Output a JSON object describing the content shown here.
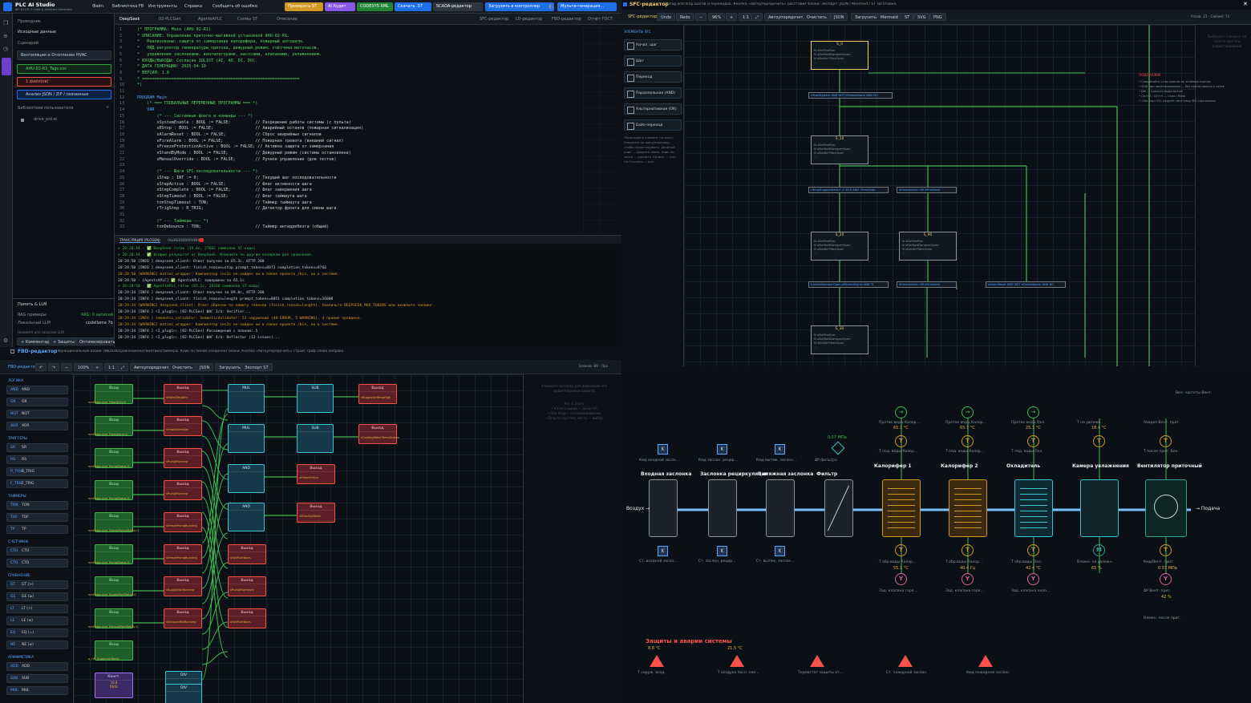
{
  "app": {
    "title": "PLC AI Studio",
    "subtitle": "IEC 61131-3 Code & Architect Generator",
    "menu": [
      "Файл",
      "Библиотека FB",
      "Инструменты",
      "Справка",
      "Сообщить об ошибке"
    ],
    "actions": [
      {
        "label": "Проверить ST",
        "color": "#d29922"
      },
      {
        "label": "AI Аудит",
        "color": "#8957e5"
      },
      {
        "label": "CODESYS XML",
        "color": "#238636"
      },
      {
        "label": "Скачать .ST",
        "color": "#1f6feb"
      },
      {
        "label": "SCADA-редактор",
        "color": "#30363d"
      },
      {
        "label": "Загрузить в контроллер",
        "color": "#1f6feb"
      },
      {
        "label": "Мульти-генерация...",
        "color": "#1f6feb"
      }
    ],
    "tabs": [
      "DeepSeek",
      "02-PLCGen",
      "AgentsAPLC",
      "Схемы ST",
      "Описание"
    ],
    "tabs_right": [
      "SFC-редактор",
      "LD-редактор",
      "FBD-редактор",
      "Отчёт ГОСТ"
    ]
  },
  "sidebar": {
    "section": "Проводник",
    "sub": "Исходные данные",
    "label2": "Сценарий",
    "scenario": "Вентиляция и Отопление HVAC",
    "file": "AHU-02-R1_Tags.csv",
    "errors": "1 файл(ов)",
    "analyze": "Анализ JSON / ZIP / связанные",
    "lib": "Библиотеки пользователя",
    "libfile": "drive_pid.st",
    "llm": "Память & LLM",
    "rag": "RAG примеры",
    "rag_v": "RAG: 0 записей",
    "local": "Локальный LLM",
    "local_v": "codellama 7b",
    "hint": "Нажмите для загрузки LLM",
    "btns": [
      "+ Комментарии",
      "+ Защиты",
      "Оптимизировать"
    ]
  },
  "code": [
    [
      "1",
      "(* ПРОГРАММА: Main (AHU-02-R1)",
      "cm"
    ],
    [
      "2",
      "* ОПИСАНИЕ: Управление приточно-вытяжной установкой AHU-02-R1.",
      "cm"
    ],
    [
      "3",
      "*   Реализованы: защита от замерзания калорифера, пожарный алгоритм,",
      "cm"
    ],
    [
      "4",
      "*   ПИД-регулятор температуры притока, дежурный режим, счётчики моточасов,",
      "cm"
    ],
    [
      "5",
      "*   управление заслонками, вентиляторами, насосами, клапанами, увлажнением.",
      "cm"
    ],
    [
      "6",
      "* ВХОДЫ/ВЫХОДЫ: Согласно IOLIST (AI, AO, DI, DO).",
      "cm"
    ],
    [
      "7",
      "* ДАТА ГЕНЕРАЦИИ: 2025-04-10",
      "cm"
    ],
    [
      "8",
      "* ВЕРСИЯ: 1.0",
      "cm"
    ],
    [
      "9",
      "* ================================================================",
      "cm"
    ],
    [
      "10",
      "*)",
      "cm"
    ],
    [
      "11",
      "",
      ""
    ],
    [
      "12",
      "PROGRAM Main",
      "kw"
    ],
    [
      "13",
      "    (* === ГЛОБАЛЬНЫЕ ПЕРЕМЕННЫЕ ПРОГРАММЫ === *)",
      "cm"
    ],
    [
      "14",
      "    VAR",
      "kw"
    ],
    [
      "15",
      "        (* --- Системные флаги и команды --- *)",
      "cm"
    ],
    [
      "16",
      "        xSystemEnable : BOOL := FALSE;          // Разрешение работы системы (с пульта)",
      ""
    ],
    [
      "17",
      "        xEStop : BOOL := FALSE;                 // Аварийный останов (пожарная сигнализация)",
      ""
    ],
    [
      "18",
      "        xAlarmReset : BOOL := FALSE;            // Сброс аварийных сигналов",
      ""
    ],
    [
      "19",
      "        xFireAlarm : BOOL := FALSE;             // Пожарная тревога (внешний сигнал)",
      ""
    ],
    [
      "20",
      "        xFreezeProtectionActive : BOOL := FALSE; // Активна защита от замерзания",
      ""
    ],
    [
      "21",
      "        xStandByMode : BOOL := FALSE;           // Дежурный режим (система остановлена)",
      ""
    ],
    [
      "22",
      "        xManualOverride : BOOL := FALSE;        // Ручное управление (для тестов)",
      ""
    ],
    [
      "23",
      "",
      ""
    ],
    [
      "24",
      "        (* --- Шаги SFC-последовательности --- *)",
      "cm"
    ],
    [
      "25",
      "        iStep : INT := 0;                       // Текущий шаг последовательности",
      ""
    ],
    [
      "26",
      "        xStepActive : BOOL := FALSE;            // Флаг активности шага",
      ""
    ],
    [
      "27",
      "        xStepComplete : BOOL := FALSE;          // Флаг завершения шага",
      ""
    ],
    [
      "28",
      "        xStepTimeout : BOOL := FALSE;           // Флаг таймаута шага",
      ""
    ],
    [
      "29",
      "        tonStepTimeout : TON;                   // Таймер таймаута шага",
      ""
    ],
    [
      "30",
      "        rTrigStep : R_TRIG;                     // Детектор фронта для смены шага",
      ""
    ],
    [
      "31",
      "",
      ""
    ],
    [
      "32",
      "        (* --- Таймеры --- *)",
      "cm"
    ],
    [
      "33",
      "        tonDebounce : TON;                      // Таймер антидребезга (общий)",
      ""
    ]
  ],
  "log_tabs": [
    "ТРАНСЛЯЦИЯ (PLCGEN)",
    "ОШИБКИ/ВАРНИНГИ"
  ],
  "log": [
    "> 20:28:44 - ✅ DeepSeek готов (39.8с, 27682 символов ST-кода)",
    "> 20:28:44 - ✅ Вторые результат от DeepSeek. Кликайте по другим вкладкам для сравнения.",
    "20:28:50 [INFO ] deepseek_client: Ответ получен за 65.3с, HTTP 200",
    "20:28:50 [INFO ] deepseek_client: finish_reason=stop prompt_tokens=8873 completion_tokens=9766",
    "20:28:50 [WARNING] matiec_wrapper: Компилятор iec2c не найден ни в папке проекта /bin, ни в системе.",
    "20:28:50 - [AgentsAPLC] ✅ AgentsAPLC: завершено за 65.1с",
    "> 20:28:50 - ✅ AgentsAPLC готов (65.1с, 28318 символов ST-кода)",
    "20:29:34 [INFO ] deepseek_client: Ответ получен за 89.0с, HTTP 200",
    "20:29:34 [INFO ] deepseek_client: finish_reason=length prompt_tokens=8051 completion_tokens=16000",
    "20:29:34 [WARNING] deepseek_client: Ответ обрезан по лимиту токенов (finish_reason=length). Увеличьте DEEPSEEK_MAX_TOKENS или включите чанкинг.",
    "20:29:34 [INFO ] r2_plugin: [02-PLCGen] ШАГ 3/4: Verifier...",
    "20:29:34 [INFO ] semantic_validator: SemanticValidator: 53 нарушений (48 ERROR, 5 WARNING), 4 правил пройдено.",
    "20:29:34 [WARNING] matiec_wrapper: Компилятор iec2c не найден ни в папке проекта /bin, ни в системе.",
    "20:29:34 [INFO ] r2_plugin: [02-PLCGen] Расхождений с планом: 5",
    "20:29:34 [INFO ] r2_plugin: [02-PLCGen] ШАГ 4/4: Reflector (13 issues)..."
  ],
  "sfc": {
    "title": "SFC-редактор",
    "hint": "Drag and drop шагов и переходов. Кнопка «Автоупорядочить» расставит блоки. Экспорт: JSON / Mermaid / ST заготовка.",
    "toolbar": [
      "SFC-редактор",
      "Undo",
      "Redo",
      "−",
      "96%",
      "+",
      "1:1",
      "⤢",
      "Автоупорядочить",
      "Очистить",
      "JSON",
      "Загрузить",
      "Mermaid",
      "ST",
      "SVG",
      "PNG"
    ],
    "status": "Узлов: 23 · Связей: 74",
    "pal_title": "ЭЛЕМЕНТЫ SFC",
    "pal": [
      "Начал. шаг",
      "Шаг",
      "Переход",
      "Параллельная (AND)",
      "Альтернативная (OR)",
      "Байп-переход"
    ],
    "pal_note": "Перетащите элемент на холст. Кликните по шагу/переходу, чтобы редактировать. Двойной клик — удалить связь. Клик по связи — удалить. Колесо — зум. Ctrl+колесо — pan.",
    "help_title": "ПОДСКАЗКИ",
    "help": [
      "• Соединяйте узлы кликом по зелёным портам",
      "• Shift при перетаскивании — без притягивания к сетке",
      "• Del — удалить выделенное",
      "• Ctrl+Z / Ctrl+Y — Undo / Redo",
      "• «Экспорт ST» создаёт заготовку SFC-программы"
    ],
    "placeholder": "Выберите элемент на холсте для его редактирования",
    "steps": [
      {
        "name": "S_0",
        "lines": [
          "N  xDelFanRun",
          "N  xDelSoftDamperOpen",
          "N  xDelAirFilterOpen",
          "..."
        ]
      },
      {
        "name": "S_10",
        "lines": [
          "N  xDelFanRun",
          "N  xDelSoftDamperOpen",
          "N  xDelAirFilterOpen",
          "..."
        ]
      },
      {
        "name": "S_20",
        "lines": [
          "N  xDelFanRun",
          "N  xDelSoftDamperOpen",
          "N  xDelAirFilterOpen",
          "..."
        ]
      },
      {
        "name": "S_90",
        "lines": [
          "N  xDelFanRun",
          "N  xDelSoftDamperOpen",
          "N  xDelAirFilterOpen",
          "..."
        ]
      },
      {
        "name": "S_30",
        "lines": [
          "N  xDelFanRun",
          "N  xDelSoftDamperOpen",
          "N  xDelAirFilterOpen",
          "..."
        ]
      }
    ],
    "trans": [
      "xStartSystem AND NOT bFreezeAlarm AND NO",
      "rTempSupplyHeater1 > 20.0 AND rTempSetp",
      "bFreezeAlarm OR bFireAlarm",
      "fUnlockDamperOpen.sFilteredSignal AND TI",
      "bFreezeAlarm OR bFireAlarm",
      "xAlarmReset AND NOT bFreezeAlarm AND NO"
    ]
  },
  "fbd": {
    "title": "FBD-редактор",
    "hint": "Функциональные блоки: AND/OR/сравнение/математика/таймеры. Клик по пинам соединяет блоки. Кнопка «Автоупорядочить» строит граф слева направо.",
    "toolbar": [
      "FBD-редактор",
      "↶",
      "↷",
      "−",
      "100%",
      "+",
      "1:1",
      "⤢",
      "Автоупорядочить",
      "Очистить",
      "JSON",
      "Загрузить",
      "Экспорт ST"
    ],
    "status": "Блоков: 89 · Про",
    "palette": [
      {
        "cat": "ЛОГИКА",
        "items": [
          [
            "AND",
            "AND"
          ],
          [
            "OR",
            "OR"
          ],
          [
            "NOT",
            "NOT"
          ],
          [
            "XOR",
            "XOR"
          ]
        ]
      },
      {
        "cat": "ТРИГГЕРЫ",
        "items": [
          [
            "SR",
            "SR"
          ],
          [
            "RS",
            "RS"
          ],
          [
            "R_TRIG",
            "R_TRIG"
          ],
          [
            "F_TRIG",
            "F_TRIG"
          ]
        ]
      },
      {
        "cat": "ТАЙМЕРЫ",
        "items": [
          [
            "TON",
            "TON"
          ],
          [
            "TOF",
            "TOF"
          ],
          [
            "TP",
            "TP"
          ]
        ]
      },
      {
        "cat": "СЧЕТЧИКИ",
        "items": [
          [
            "CTU",
            "CTU"
          ],
          [
            "CTD",
            "CTD"
          ]
        ]
      },
      {
        "cat": "СРАВНЕНИЕ",
        "items": [
          [
            "GT",
            "GT (>)"
          ],
          [
            "GE",
            "GE (≥)"
          ],
          [
            "LT",
            "LT (<)"
          ],
          [
            "LE",
            "LE (≤)"
          ],
          [
            "EQ",
            "EQ (=)"
          ],
          [
            "NE",
            "NE (≠)"
          ]
        ]
      },
      {
        "cat": "АРИФМЕТИКА",
        "items": [
          [
            "ADD",
            "ADD"
          ],
          [
            "SUB",
            "SUB"
          ],
          [
            "MUL",
            "MUL"
          ]
        ]
      }
    ],
    "right_hint": [
      "Кликните по блоку для изменения его",
      "редактируемых свойств",
      "Pan & Zoom",
      "• Колесо мыши — масштаб",
      "• Пкм drag — панорамирование",
      "• Drag по пустому месту — выбор"
    ],
    "inputs": [
      "tonDebounce_FilterDirty.Q",
      "tonDebounce_FrostAlarm.Q",
      "tonDebounce_PumpStatus.Q",
      "tonDebounce_PumpStatus.Q",
      "tonDebounce_FreezePumpStatus.Q",
      "tonDebounce_PumpStatus.Q",
      "tonDebounce_SupplyFanStatus.Q",
      "tonDebounce_ExhaustFanStatus.Q",
      "g_rHI_SupplyAirTemp"
    ],
    "outputs": [
      "xFilterDirtyAlm",
      "xFrostAlarmAlm",
      "xPumpRunning",
      "xPumpRunning",
      "xFreezePumpRunning",
      "xFreezePumpRunning",
      "xSupplyFanRunning",
      "xExhaustFanRunning"
    ],
    "block_in": "Вход",
    "block_out": "Выход",
    "const": "Конст.",
    "const_v": "16.8",
    "const_lbl": "REAL",
    "fn": [
      "MUL",
      "SUB",
      "MUL",
      "SUB",
      "AND",
      "AND",
      "DIV",
      "DIV"
    ],
    "right_out": [
      "xSupplyAirTempHigh",
      "xCoolingWaterTempScaled",
      "xFreezeTrAlm",
      "xStandbyMode",
      "xFanRunHours",
      "xPumpRunHours",
      "xFanRunHours"
    ]
  },
  "scada": {
    "air_in": "Воздух →",
    "air_out": "→ Подача",
    "units": [
      {
        "title": "Входная заслонка",
        "type": "damper",
        "top_cap": "Кмд входной засло...",
        "bot_cap": "Ст. входной засло..."
      },
      {
        "title": "Заслонка рециркуляции",
        "type": "damper",
        "top_cap": "Кмд заслон. рецир...",
        "bot_cap": "Ст. заслон. рецир..."
      },
      {
        "title": "Вытяжная заслонка",
        "type": "damper",
        "top_cap": "Кмд вытяж. заслон...",
        "bot_cap": "Ст. вытяж. заслон..."
      },
      {
        "title": "Фильтр",
        "type": "filter",
        "top_cap": "ΔP фильтра",
        "top_val": "0.57 MПа"
      },
      {
        "title": "Калорифер 1",
        "type": "heater",
        "t1": "Проток воды Калор...",
        "t1v": "65.1 °C",
        "t2": "Т под. воды Калор...",
        "b1": "Т обр.воды Калор...",
        "b1v": "55.1 °C",
        "b2": "Зад. клапана горя..."
      },
      {
        "title": "Калорифер 2",
        "type": "heater",
        "t1": "Проток воды Калор...",
        "t1v": "65.7 °C",
        "t2": "Т под. воды Калор...",
        "b1": "Т обр.воды Калор...",
        "b1v": "40.4 Гц",
        "b2": "Зад. клапана горя..."
      },
      {
        "title": "Охладитель",
        "type": "cooler",
        "t1": "Проток воды Охл.",
        "t1v": "25.1 °C",
        "t2": "Т под. воды Охл.",
        "b1": "Т обр.воды Охл.",
        "b1v": "42.4 °C",
        "b2": "Зад. клапана холо..."
      },
      {
        "title": "Камера увлажнения",
        "type": "humid",
        "t1": "Т на увлажн.",
        "t1v": "18.4 °C",
        "b1": "Влажн. на увлажн.",
        "b1v": "65 %"
      },
      {
        "title": "Вентилятор приточный",
        "type": "fan",
        "t1": "Авария Вент. прит.",
        "t2": "Т после прит. Вен.",
        "t0": "Вкл. частоты Вент.",
        "b1": "Кмд/Вент. прит.",
        "b1v": "0.57 MПа",
        "b2": "ΔP Вент. прит.",
        "b2v": "42 %",
        "b3": "Влажн. после прит."
      }
    ],
    "prot_title": "Защиты и аварии системы",
    "prot_v1": "8.8 °C",
    "prot_v2": "21.5 °C",
    "alarms": [
      "Т наруж. возд.",
      "Т воздуха посл. сме...",
      "Термостат защиты от...",
      "Ст. пожарной заслон.",
      "Кмд пожарной заслон."
    ]
  },
  "colors": {
    "accent": "#58a6ff",
    "ok": "#3fb950",
    "alarm": "#f85149",
    "warn": "#d29922",
    "pink": "#db61a2",
    "teal": "#2ea39b"
  }
}
